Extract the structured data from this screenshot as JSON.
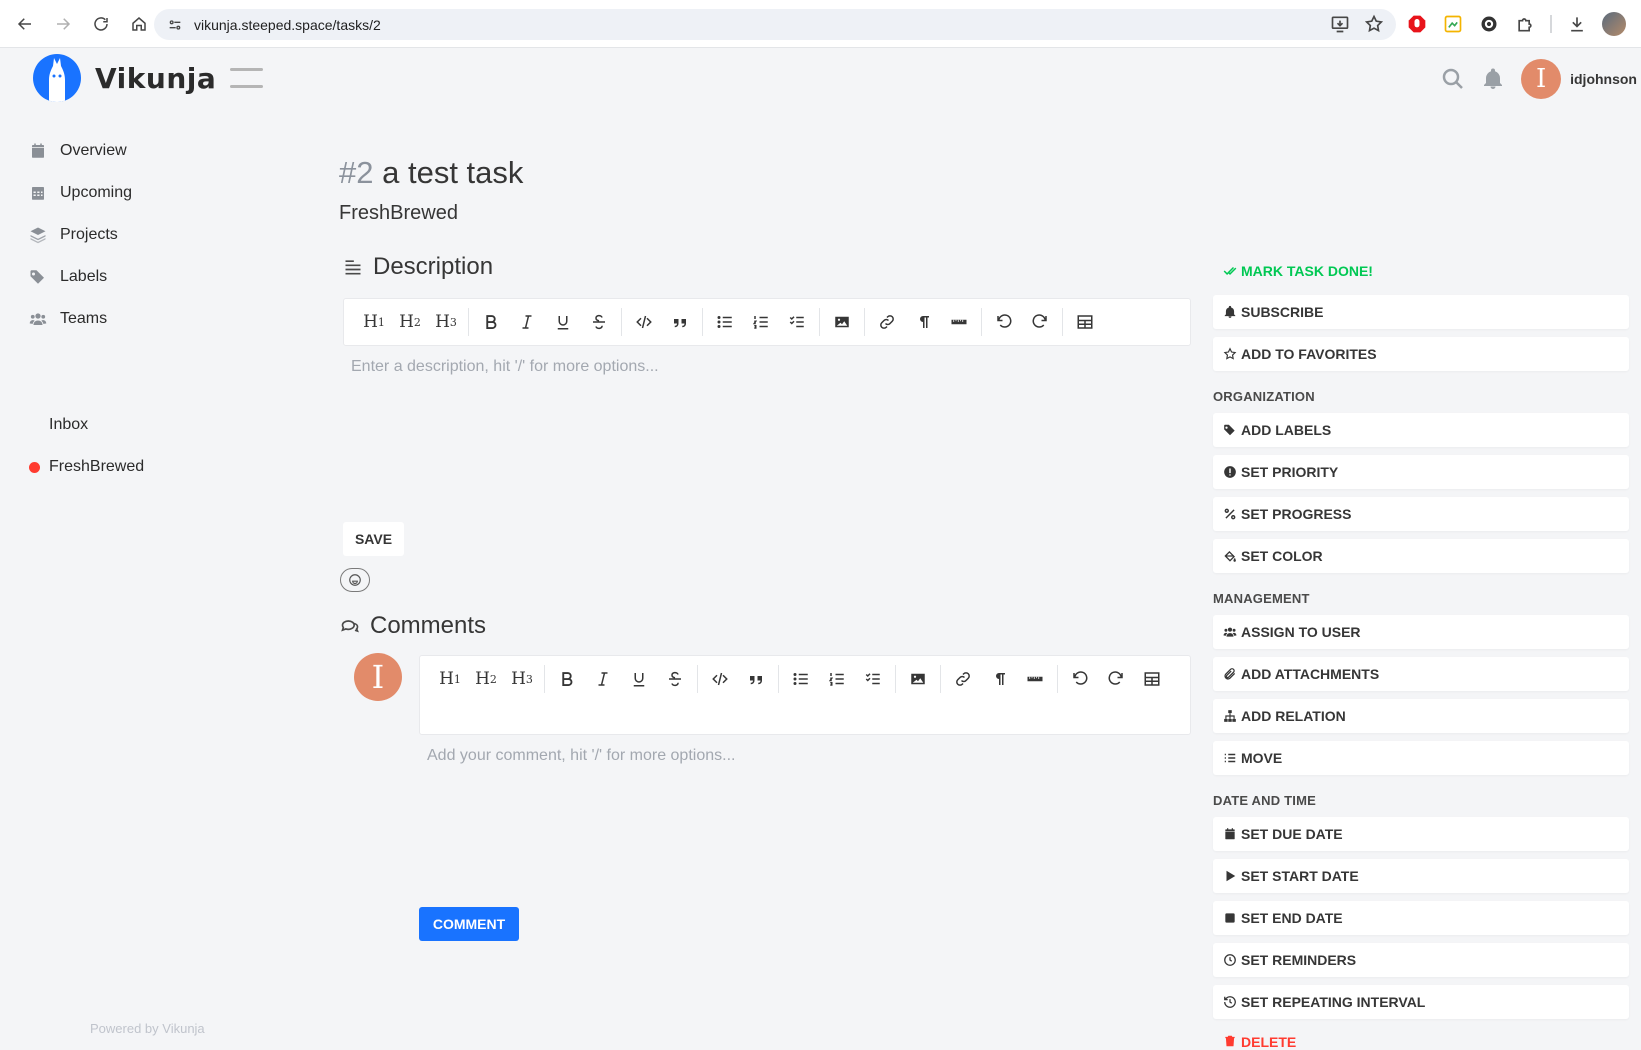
{
  "browser": {
    "url": "vikunja.steeped.space/tasks/2"
  },
  "app": {
    "name": "Vikunja",
    "username": "idjohnson",
    "avatar_letter": "I",
    "powered_by": "Powered by Vikunja"
  },
  "sidebar": {
    "items": [
      {
        "label": "Overview",
        "icon": "calendar-icon"
      },
      {
        "label": "Upcoming",
        "icon": "calendar-grid-icon"
      },
      {
        "label": "Projects",
        "icon": "layers-icon"
      },
      {
        "label": "Labels",
        "icon": "tags-icon"
      },
      {
        "label": "Teams",
        "icon": "users-icon"
      }
    ],
    "projects": [
      {
        "label": "Inbox",
        "color": ""
      },
      {
        "label": "FreshBrewed",
        "color": "#ff3b30"
      }
    ]
  },
  "task": {
    "id": "#2",
    "title": "a test task",
    "project": "FreshBrewed"
  },
  "description": {
    "heading": "Description",
    "placeholder": "Enter a description, hit '/' for more options...",
    "save_label": "SAVE"
  },
  "comments": {
    "heading": "Comments",
    "placeholder": "Add your comment, hit '/' for more options...",
    "comment_label": "COMMENT"
  },
  "actions": {
    "mark_done": "MARK TASK DONE!",
    "subscribe": "SUBSCRIBE",
    "favorite": "ADD TO FAVORITES",
    "organization_heading": "ORGANIZATION",
    "labels": "ADD LABELS",
    "priority": "SET PRIORITY",
    "progress": "SET PROGRESS",
    "color": "SET COLOR",
    "management_heading": "MANAGEMENT",
    "assign": "ASSIGN TO USER",
    "attachments": "ADD ATTACHMENTS",
    "relation": "ADD RELATION",
    "move": "MOVE",
    "datetime_heading": "DATE AND TIME",
    "due_date": "SET DUE DATE",
    "start_date": "SET START DATE",
    "end_date": "SET END DATE",
    "reminders": "SET REMINDERS",
    "repeat": "SET REPEATING INTERVAL",
    "delete": "DELETE"
  },
  "colors": {
    "primary": "#1973ff",
    "success": "#00c853",
    "danger": "#ff3b30",
    "avatar": "#e28b6a"
  }
}
